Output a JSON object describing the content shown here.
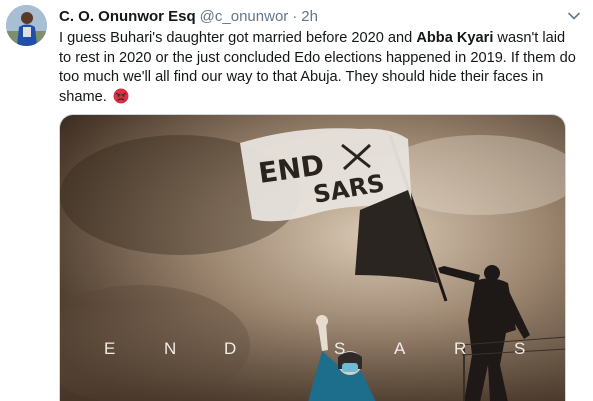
{
  "tweet": {
    "author_name": "C. O. Onunwor Esq",
    "handle": "@c_onunwor",
    "separator": "·",
    "time": "2h",
    "text_segments": [
      "I guess Buhari's daughter got married before 2020 and ",
      "Abba Kyari",
      " wasn't laid to rest in 2020 or the just concluded Edo elections happened in 2019. If them do too much we'll all find our way to that Abuja. They should hide their faces in shame. "
    ],
    "emoji": "angry-face-emoji",
    "menu_icon": "chevron-down-icon"
  },
  "media": {
    "banner_text": "END SARS",
    "flag_text_line1": "END",
    "flag_text_line2": "SARS",
    "spaced_letters": [
      "E",
      "N",
      "D",
      "S",
      "A",
      "R",
      "S"
    ],
    "colors": {
      "sky_dark": "#3a2a1e",
      "sky_light": "#c9b8a4",
      "flag_white": "#e8e3dd",
      "flag_dark": "#2b2522"
    }
  }
}
